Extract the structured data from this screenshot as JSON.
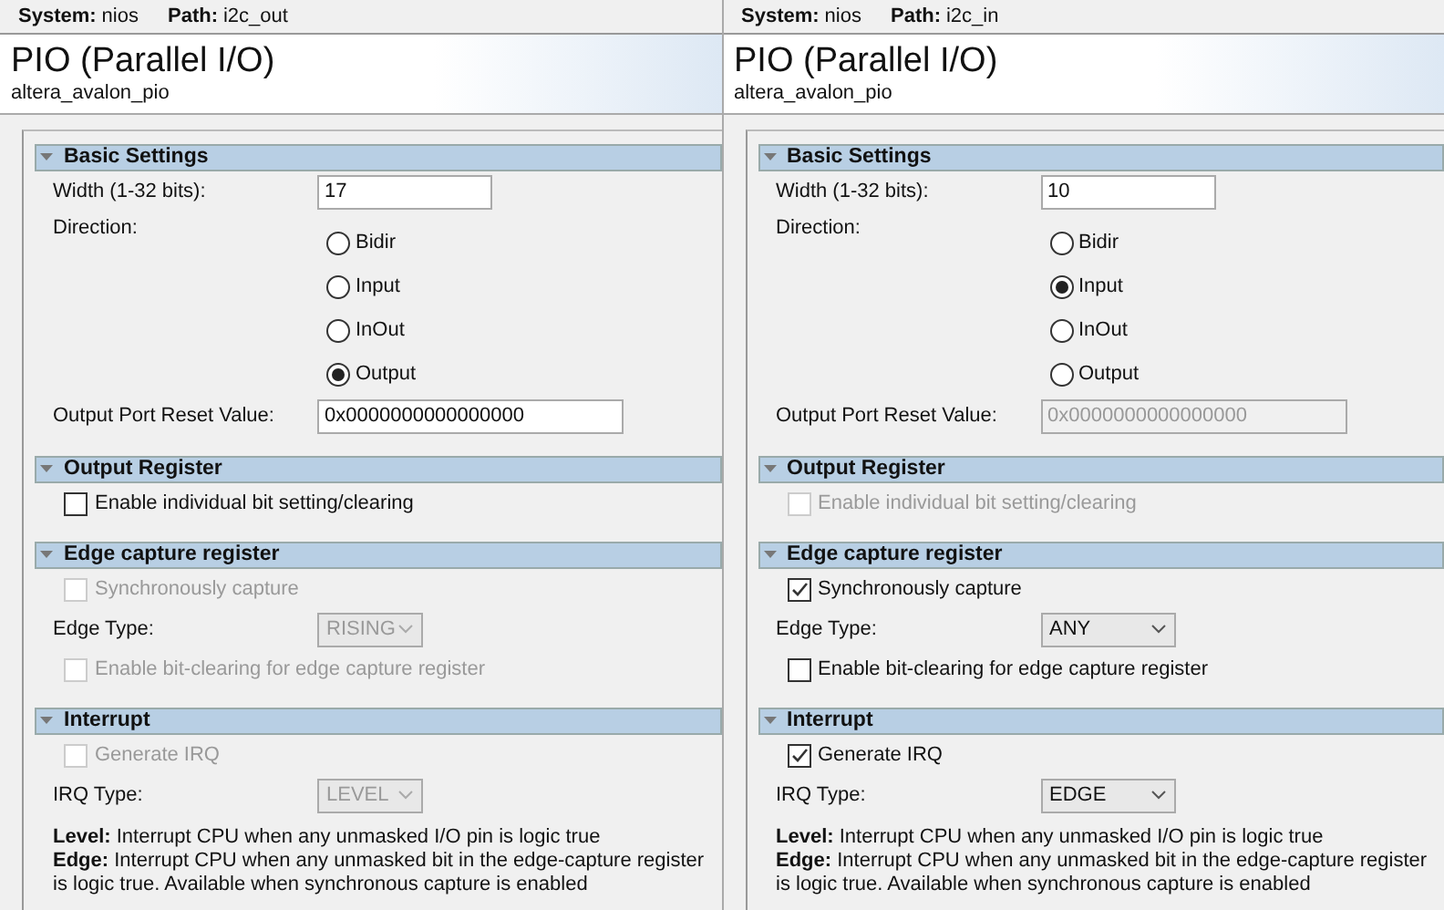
{
  "panels": [
    {
      "system_label": "System:",
      "system": "nios",
      "path_label": "Path:",
      "path": "i2c_out",
      "title": "PIO (Parallel I/O)",
      "subtitle": "altera_avalon_pio",
      "sections": [
        {
          "title": "Basic Settings",
          "expanded": true,
          "rows": [
            {
              "kind": "text",
              "label": "Width (1-32 bits):",
              "value": "17",
              "disabled": false
            },
            {
              "kind": "radio",
              "label": "Direction:",
              "options": [
                {
                  "label": "Bidir",
                  "selected": false
                },
                {
                  "label": "Input",
                  "selected": false
                },
                {
                  "label": "InOut",
                  "selected": false
                },
                {
                  "label": "Output",
                  "selected": true
                }
              ]
            },
            {
              "kind": "text",
              "label": "Output Port Reset Value:",
              "value": "0x0000000000000000",
              "disabled": false
            }
          ]
        },
        {
          "title": "Output Register",
          "expanded": true,
          "rows": [
            {
              "kind": "checkbox",
              "label": "Enable individual bit setting/clearing",
              "checked": false,
              "disabled": false
            }
          ]
        },
        {
          "title": "Edge capture register",
          "expanded": true,
          "rows": [
            {
              "kind": "checkbox",
              "label": "Synchronously capture",
              "checked": false,
              "disabled": true
            },
            {
              "kind": "select",
              "label": "Edge Type:",
              "value": "RISING",
              "disabled": true
            },
            {
              "kind": "checkbox",
              "label": "Enable bit-clearing for edge capture register",
              "checked": false,
              "disabled": true
            }
          ]
        },
        {
          "title": "Interrupt",
          "expanded": true,
          "rows": [
            {
              "kind": "checkbox",
              "label": "Generate IRQ",
              "checked": false,
              "disabled": true
            },
            {
              "kind": "select",
              "label": "IRQ Type:",
              "value": "LEVEL",
              "disabled": true
            },
            {
              "kind": "note",
              "text": "**Level:** Interrupt CPU when any unmasked I/O pin is logic true"
            },
            {
              "kind": "note",
              "text": "**Edge:** Interrupt CPU when any unmasked bit in the edge-capture register is logic true. Available when synchronous capture is enabled"
            }
          ]
        }
      ]
    },
    {
      "system_label": "System:",
      "system": "nios",
      "path_label": "Path:",
      "path": "i2c_in",
      "title": "PIO (Parallel I/O)",
      "subtitle": "altera_avalon_pio",
      "sections": [
        {
          "title": "Basic Settings",
          "expanded": true,
          "rows": [
            {
              "kind": "text",
              "label": "Width (1-32 bits):",
              "value": "10",
              "disabled": false
            },
            {
              "kind": "radio",
              "label": "Direction:",
              "options": [
                {
                  "label": "Bidir",
                  "selected": false
                },
                {
                  "label": "Input",
                  "selected": true
                },
                {
                  "label": "InOut",
                  "selected": false
                },
                {
                  "label": "Output",
                  "selected": false
                }
              ]
            },
            {
              "kind": "text",
              "label": "Output Port Reset Value:",
              "value": "0x0000000000000000",
              "disabled": true
            }
          ]
        },
        {
          "title": "Output Register",
          "expanded": true,
          "rows": [
            {
              "kind": "checkbox",
              "label": "Enable individual bit setting/clearing",
              "checked": false,
              "disabled": true
            }
          ]
        },
        {
          "title": "Edge capture register",
          "expanded": true,
          "rows": [
            {
              "kind": "checkbox",
              "label": "Synchronously capture",
              "checked": true,
              "disabled": false
            },
            {
              "kind": "select",
              "label": "Edge Type:",
              "value": "ANY",
              "disabled": false
            },
            {
              "kind": "checkbox",
              "label": "Enable bit-clearing for edge capture register",
              "checked": false,
              "disabled": false
            }
          ]
        },
        {
          "title": "Interrupt",
          "expanded": true,
          "rows": [
            {
              "kind": "checkbox",
              "label": "Generate IRQ",
              "checked": true,
              "disabled": false
            },
            {
              "kind": "select",
              "label": "IRQ Type:",
              "value": "EDGE",
              "disabled": false
            },
            {
              "kind": "note",
              "text": "**Level:** Interrupt CPU when any unmasked I/O pin is logic true"
            },
            {
              "kind": "note",
              "text": "**Edge:** Interrupt CPU when any unmasked bit in the edge-capture register is logic true. Available when synchronous capture is enabled"
            }
          ]
        }
      ]
    }
  ]
}
